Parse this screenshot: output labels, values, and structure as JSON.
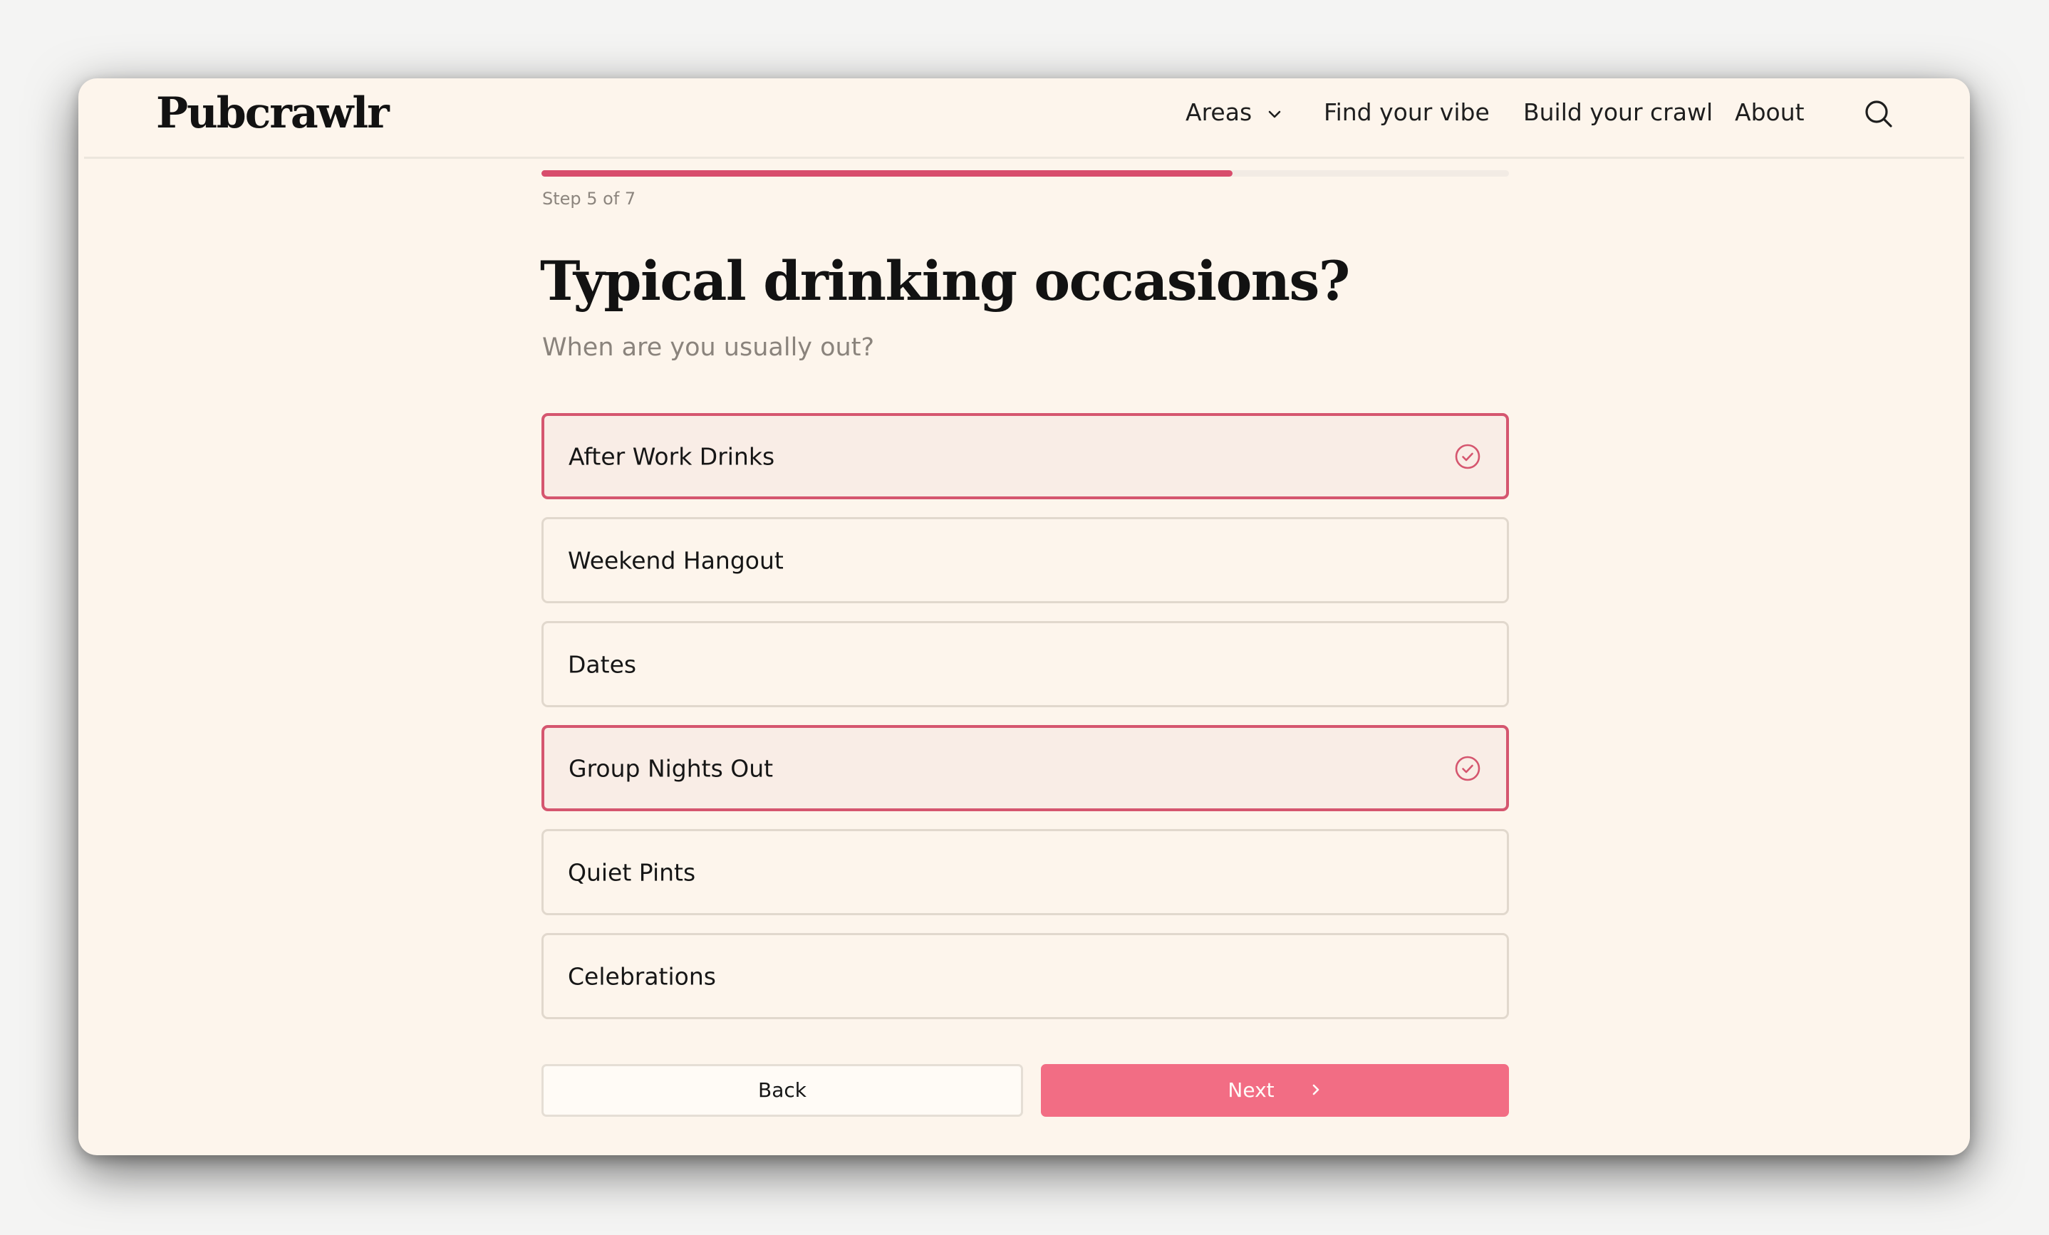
{
  "header": {
    "logo": "Pubcrawlr",
    "nav": [
      {
        "label": "Areas",
        "has_dropdown": true
      },
      {
        "label": "Find your vibe"
      },
      {
        "label": "Build your crawl"
      },
      {
        "label": "About"
      }
    ],
    "search_icon": "search-icon"
  },
  "progress": {
    "step_label": "Step 5 of 7",
    "current": 5,
    "total": 7
  },
  "question": {
    "title": "Typical drinking occasions?",
    "subtitle": "When are you usually out?"
  },
  "options": [
    {
      "label": "After Work Drinks",
      "selected": true
    },
    {
      "label": "Weekend Hangout",
      "selected": false
    },
    {
      "label": "Dates",
      "selected": false
    },
    {
      "label": "Group Nights Out",
      "selected": true
    },
    {
      "label": "Quiet Pints",
      "selected": false
    },
    {
      "label": "Celebrations",
      "selected": false
    }
  ],
  "actions": {
    "back_label": "Back",
    "next_label": "Next"
  },
  "colors": {
    "accent": "#d5566f",
    "button": "#f26d84",
    "background": "#fdf5ec"
  }
}
